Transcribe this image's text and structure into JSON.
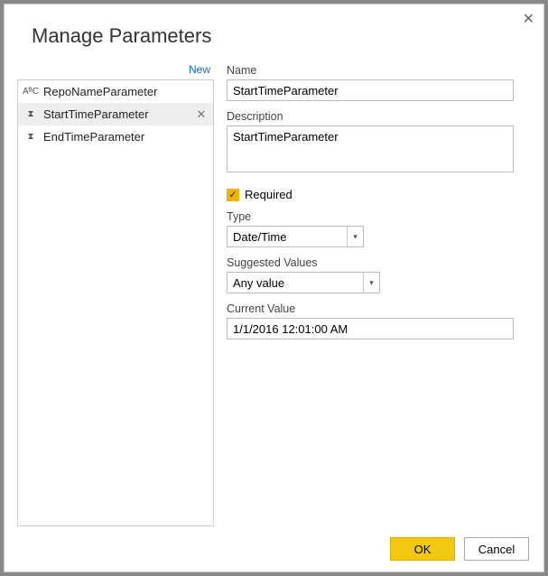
{
  "dialog": {
    "title": "Manage Parameters"
  },
  "list": {
    "new_label": "New",
    "items": [
      {
        "icon": "text",
        "label": "RepoNameParameter",
        "selected": false
      },
      {
        "icon": "datetime",
        "label": "StartTimeParameter",
        "selected": true
      },
      {
        "icon": "datetime",
        "label": "EndTimeParameter",
        "selected": false
      }
    ]
  },
  "form": {
    "name_label": "Name",
    "name_value": "StartTimeParameter",
    "desc_label": "Description",
    "desc_value": "StartTimeParameter",
    "required_checked": true,
    "required_label": "Required",
    "type_label": "Type",
    "type_value": "Date/Time",
    "suggested_label": "Suggested Values",
    "suggested_value": "Any value",
    "current_label": "Current Value",
    "current_value": "1/1/2016 12:01:00 AM"
  },
  "footer": {
    "ok": "OK",
    "cancel": "Cancel"
  },
  "icons": {
    "text": "AᴮC",
    "datetime": "⧗",
    "close_x": "✕",
    "check": "✓",
    "caret": "▾",
    "item_x": "✕"
  }
}
